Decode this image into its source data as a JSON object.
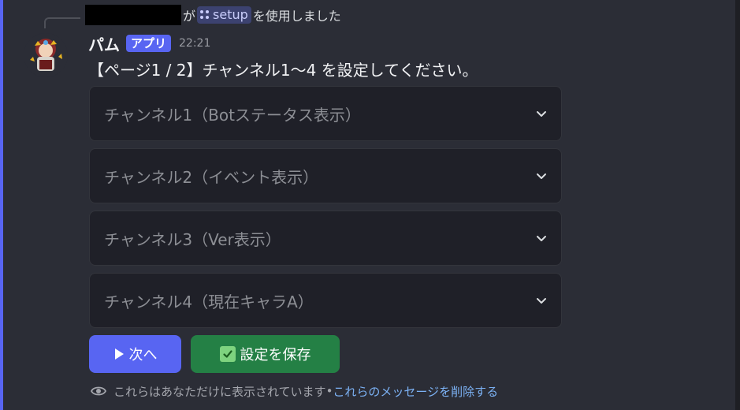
{
  "interaction": {
    "suffix": "が",
    "command": "setup",
    "tail": "を使用しました"
  },
  "message": {
    "username": "パム",
    "app_badge": "アプリ",
    "timestamp": "22:21",
    "content": "【ページ1 / 2】チャンネル1〜4 を設定してください。"
  },
  "selects": [
    {
      "placeholder": "チャンネル1（Botステータス表示）"
    },
    {
      "placeholder": "チャンネル2（イベント表示）"
    },
    {
      "placeholder": "チャンネル3（Ver表示）"
    },
    {
      "placeholder": "チャンネル4（現在キャラA）"
    }
  ],
  "buttons": {
    "next_label": "次へ",
    "save_label": "設定を保存"
  },
  "footer": {
    "notice": "これらはあなただけに表示されています",
    "separator": " • ",
    "dismiss_link": "これらのメッセージを削除する"
  },
  "colors": {
    "accent": "#5865f2",
    "success": "#248045",
    "link": "#7cb2f5"
  },
  "icons": [
    "slash-command-icon",
    "chevron-down-icon",
    "play-icon",
    "checkbox-icon",
    "eye-icon"
  ]
}
